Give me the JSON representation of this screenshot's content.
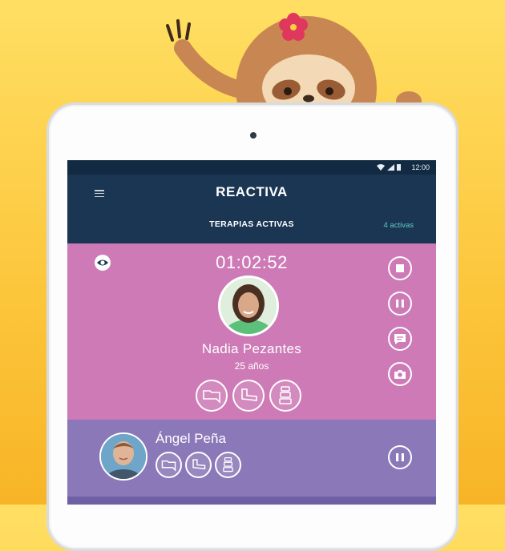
{
  "statusbar": {
    "time": "12:00"
  },
  "appbar": {
    "brand": "REACTIVA",
    "title": "TERAPIAS ACTIVAS",
    "count": "4 activas"
  },
  "active_session": {
    "timer": "01:02:52",
    "patient_name": "Nadia Pezantes",
    "age": "25 años",
    "therapies": [
      "leg-therapy-icon",
      "foot-therapy-icon",
      "spine-therapy-icon"
    ],
    "controls": [
      "stop-icon",
      "pause-icon",
      "chat-icon",
      "camera-icon"
    ]
  },
  "second_session": {
    "patient_name": "Ángel Peña",
    "therapies": [
      "leg-therapy-icon",
      "foot-therapy-icon",
      "spine-therapy-icon"
    ],
    "controls": [
      "pause-icon"
    ]
  },
  "colors": {
    "card_active": "#cd7ab6",
    "card_second": "#8b78b8",
    "appbar": "#1a3652",
    "accent": "#62c9c1"
  }
}
